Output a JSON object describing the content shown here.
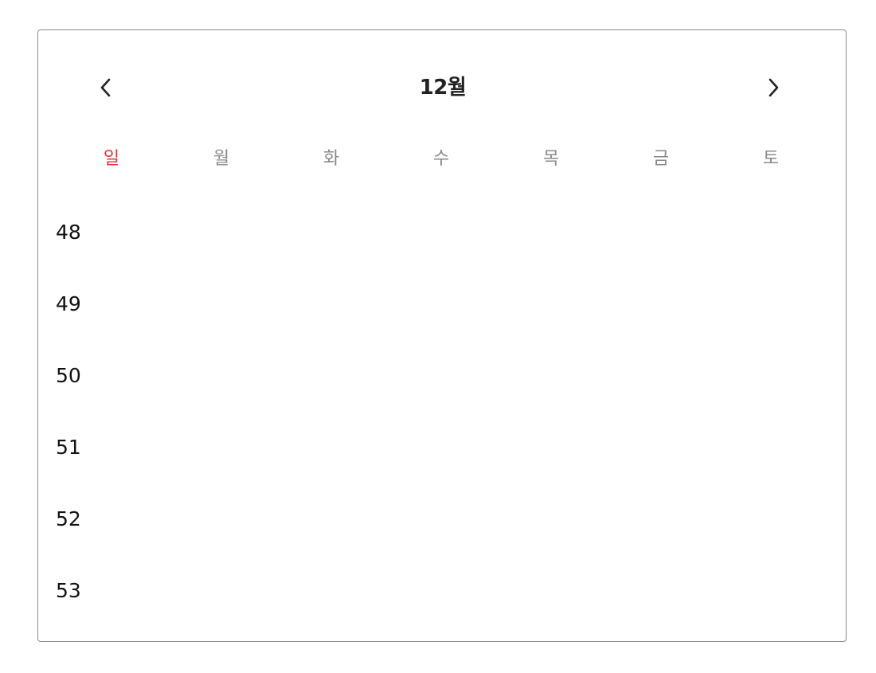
{
  "header": {
    "month_title": "12월",
    "prev_icon": "chevron-left-icon",
    "next_icon": "chevron-right-icon"
  },
  "weekdays": [
    "일",
    "월",
    "화",
    "수",
    "목",
    "금",
    "토"
  ],
  "colors": {
    "sunday": "#e5303a",
    "weekday": "#8a8a8a",
    "title": "#222222",
    "border": "#8a8a8a"
  },
  "weeks": [
    {
      "number": "48"
    },
    {
      "number": "49"
    },
    {
      "number": "50"
    },
    {
      "number": "51"
    },
    {
      "number": "52"
    },
    {
      "number": "53"
    }
  ]
}
